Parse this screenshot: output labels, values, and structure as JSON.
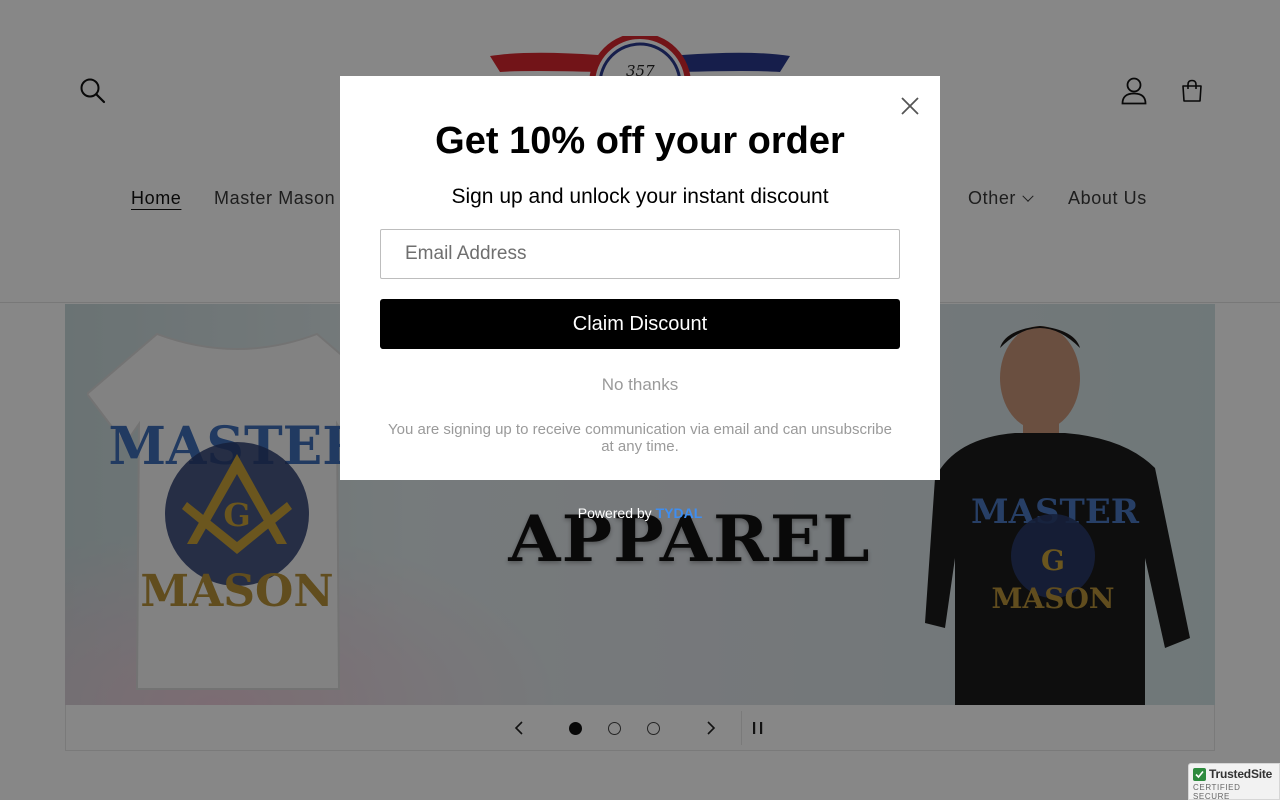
{
  "header": {
    "logo_text": "357",
    "nav": [
      {
        "label": "Home",
        "active": true
      },
      {
        "label": "Master Mason",
        "has_dropdown": false
      },
      {
        "label": "Other",
        "has_dropdown": true
      },
      {
        "label": "About Us",
        "has_dropdown": false
      }
    ]
  },
  "banner": {
    "headline": "APPAREL",
    "slides_total": 3,
    "active_slide": 1
  },
  "popup": {
    "title": "Get 10% off your order",
    "subtitle": "Sign up and unlock your instant discount",
    "email_placeholder": "Email Address",
    "claim_label": "Claim Discount",
    "no_thanks_label": "No thanks",
    "disclaimer": "You are signing up to receive communication via email and can unsubscribe at any time."
  },
  "powered_by": {
    "prefix": "Powered by",
    "brand": "TYDAL"
  },
  "trust_badge": {
    "name": "TrustedSite",
    "sub": "CERTIFIED SECURE"
  },
  "icons": {
    "search": "search-icon",
    "account": "account-icon",
    "cart": "cart-icon",
    "close": "close-icon",
    "prev": "chevron-left-icon",
    "next": "chevron-right-icon",
    "pause": "pause-icon"
  },
  "colors": {
    "overlay": "#000000",
    "button": "#000000",
    "brand_link": "#3f8ef0",
    "logo_red": "#d8262e",
    "logo_blue": "#2b3a8f"
  }
}
